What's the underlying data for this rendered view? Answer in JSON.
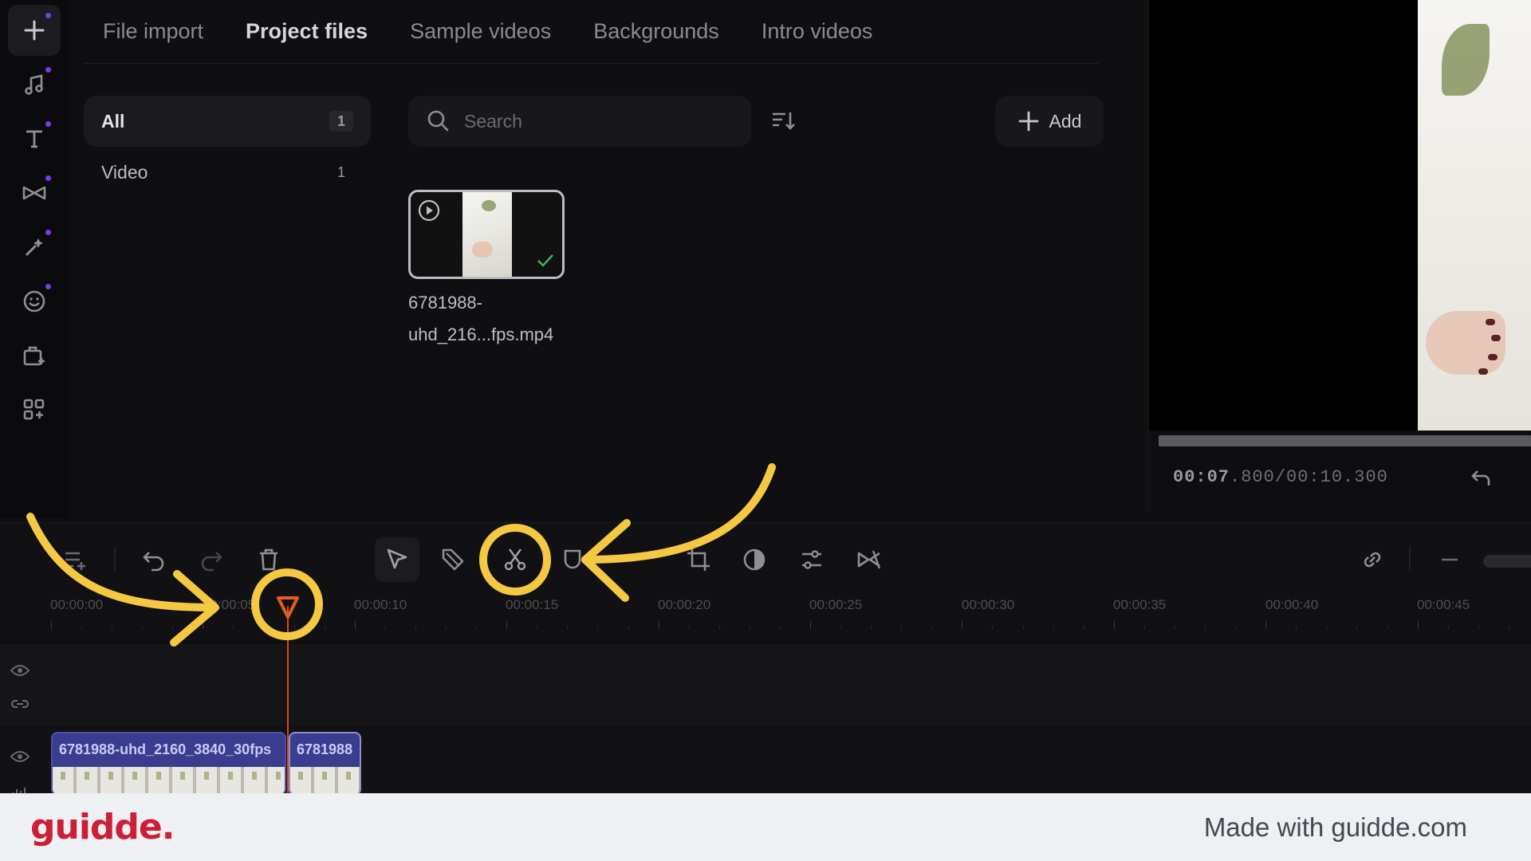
{
  "tabs": [
    {
      "label": "File import",
      "active": false
    },
    {
      "label": "Project files",
      "active": true
    },
    {
      "label": "Sample videos",
      "active": false
    },
    {
      "label": "Backgrounds",
      "active": false
    },
    {
      "label": "Intro videos",
      "active": false
    }
  ],
  "rail": {
    "items": [
      {
        "icon": "plus-icon"
      },
      {
        "icon": "music-note-icon"
      },
      {
        "icon": "text-icon"
      },
      {
        "icon": "transitions-icon"
      },
      {
        "icon": "effects-sparkle-icon"
      },
      {
        "icon": "sticker-smile-icon"
      },
      {
        "icon": "brand-kit-icon"
      },
      {
        "icon": "apps-grid-icon"
      }
    ],
    "accent": "#7c3aed"
  },
  "filters": [
    {
      "label": "All",
      "count": "1",
      "active": true
    },
    {
      "label": "Video",
      "count": "1",
      "active": false
    }
  ],
  "search": {
    "placeholder": "Search"
  },
  "add_button": {
    "label": "Add"
  },
  "media": [
    {
      "name": "6781988-uhd_216...fps.mp4",
      "name_line1": "6781988-",
      "name_line2": "uhd_216...fps.mp4"
    }
  ],
  "preview": {
    "time_current_bold": "00:07",
    "time_rest": ".800/00:10.300"
  },
  "toolbar": {
    "items": [
      "add-track-icon",
      "undo-icon",
      "redo-icon",
      "delete-icon",
      "select-pointer-icon",
      "tag-icon",
      "scissors-split-icon",
      "shield-icon",
      "crop-icon",
      "color-adjust-icon",
      "sliders-icon",
      "transition-icon",
      "link-icon",
      "zoom-out-icon"
    ]
  },
  "ruler": {
    "labels": [
      "00:00:00",
      "00:00:05",
      "00:00:10",
      "00:00:15",
      "00:00:20",
      "00:00:25",
      "00:00:30",
      "00:00:35",
      "00:00:40",
      "00:00:45"
    ]
  },
  "timeline": {
    "clips": [
      {
        "label": "6781988-uhd_2160_3840_30fps"
      },
      {
        "label": "6781988"
      }
    ],
    "playhead_color": "#d24a20",
    "clip_color": "#3a3c8e"
  },
  "annotation_color": "#f5c842",
  "footer": {
    "brand": "guidde.",
    "made_with": "Made with guidde.com"
  }
}
